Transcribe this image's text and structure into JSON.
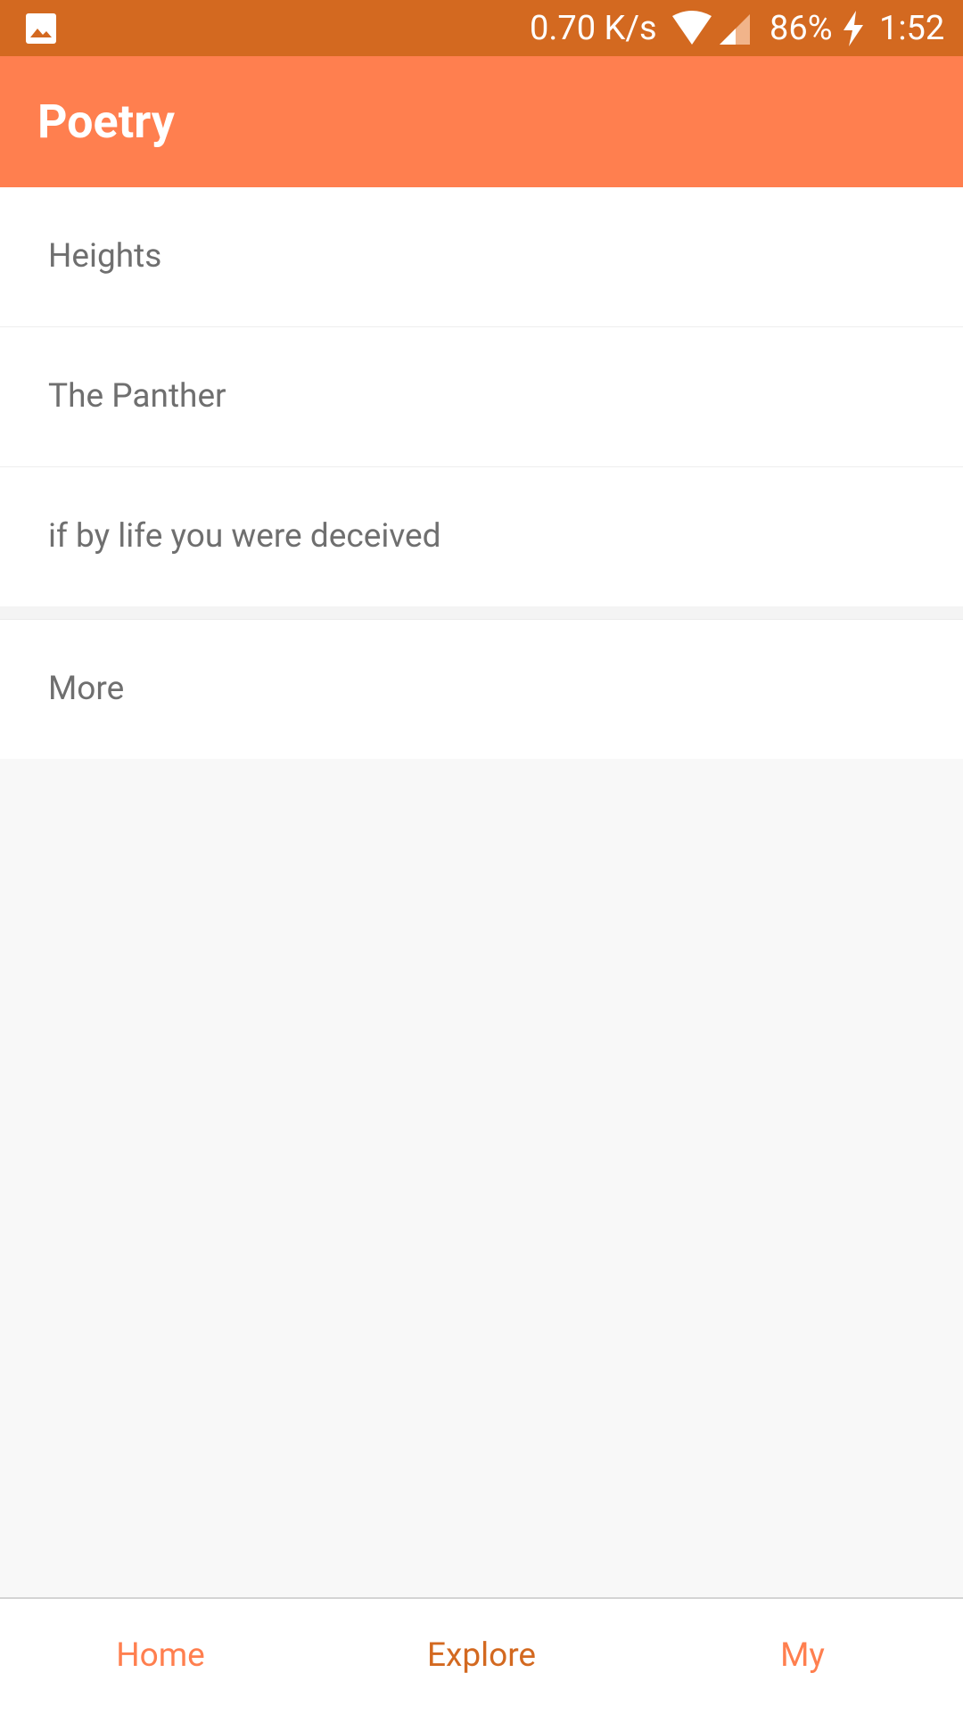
{
  "status_bar": {
    "net_speed": "0.70 K/s",
    "battery": "86%",
    "time": "1:52",
    "icons": [
      "gallery-icon",
      "wifi-icon",
      "signal-icon",
      "charging-bolt-icon"
    ]
  },
  "app_bar": {
    "title": "Poetry"
  },
  "list": {
    "items": [
      {
        "label": "Heights"
      },
      {
        "label": "The Panther"
      },
      {
        "label": "if by life you were deceived"
      }
    ],
    "more_label": "More"
  },
  "bottom_nav": {
    "tabs": [
      {
        "label": "Home"
      },
      {
        "label": "Explore"
      },
      {
        "label": "My"
      }
    ],
    "selected": "Explore"
  },
  "colors": {
    "status_bar": "#d36920",
    "app_bar": "#ff7f4f",
    "accent_selected": "#d36920",
    "accent": "#ff7f4f"
  }
}
